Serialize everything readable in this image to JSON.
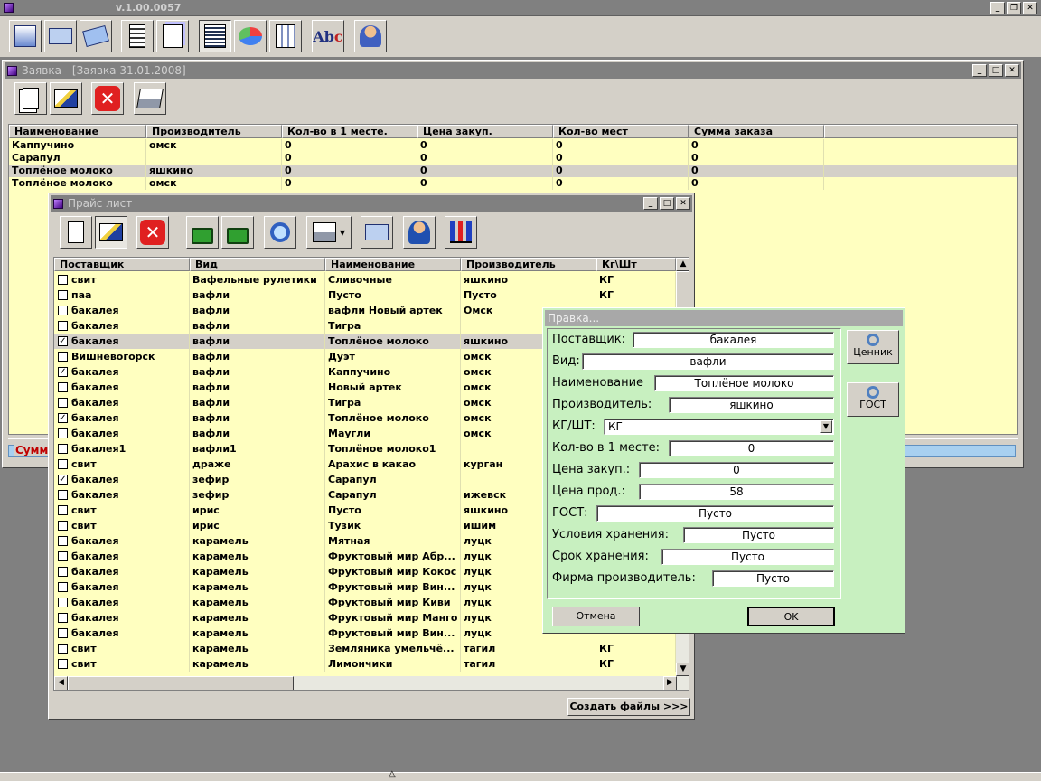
{
  "app": {
    "version": "v.1.00.0057"
  },
  "main_toolbar": [
    "list-icon",
    "mail-icon",
    "mail-multi-icon",
    "document-icon",
    "documents-icon",
    "binary-icon",
    "pie-chart-icon",
    "report-icon",
    "spellcheck-icon",
    "users-icon"
  ],
  "order_window": {
    "title": "Заявка - [Заявка 31.01.2008]",
    "columns": [
      "Наименование",
      "Производитель",
      "Кол-во в 1 месте.",
      "Цена закуп.",
      "Кол-во мест",
      "Сумма заказа"
    ],
    "rows": [
      [
        "Каппучино",
        "омск",
        "0",
        "0",
        "0",
        "0"
      ],
      [
        "Сарапул",
        "",
        "0",
        "0",
        "0",
        "0"
      ],
      [
        "Топлёное молоко",
        "яшкино",
        "0",
        "0",
        "0",
        "0"
      ],
      [
        "Топлёное молоко",
        "омск",
        "0",
        "0",
        "0",
        "0"
      ]
    ],
    "status_label": "Сумма"
  },
  "price_window": {
    "title": "Прайс лист",
    "columns": [
      "Поставщик",
      "Вид",
      "Наименование",
      "Производитель",
      "Кг\\Шт"
    ],
    "rows": [
      {
        "c": false,
        "v": [
          "свит",
          "Вафельные рулетики",
          "Сливочные",
          "яшкино",
          "КГ"
        ]
      },
      {
        "c": false,
        "v": [
          "паа",
          "вафли",
          "Пусто",
          "Пусто",
          "КГ"
        ]
      },
      {
        "c": false,
        "v": [
          "бакалея",
          "вафли",
          "вафли Новый артек",
          " Омск",
          ""
        ]
      },
      {
        "c": false,
        "v": [
          "бакалея",
          "вафли",
          "Тигра",
          "",
          ""
        ]
      },
      {
        "c": true,
        "v": [
          "бакалея",
          "вафли",
          "Топлёное молоко",
          "яшкино",
          ""
        ]
      },
      {
        "c": false,
        "v": [
          "Вишневогорск",
          "вафли",
          "Дуэт",
          "омск",
          ""
        ]
      },
      {
        "c": true,
        "v": [
          "бакалея",
          "вафли",
          "Каппучино",
          "омск",
          ""
        ]
      },
      {
        "c": false,
        "v": [
          "бакалея",
          "вафли",
          "Новый артек",
          "омск",
          ""
        ]
      },
      {
        "c": false,
        "v": [
          "бакалея",
          "вафли",
          "Тигра",
          "омск",
          ""
        ]
      },
      {
        "c": true,
        "v": [
          "бакалея",
          "вафли",
          "Топлёное молоко",
          "омск",
          ""
        ]
      },
      {
        "c": false,
        "v": [
          "бакалея",
          "вафли",
          "Маугли",
          "омск",
          ""
        ]
      },
      {
        "c": false,
        "v": [
          "бакалея1",
          "вафли1",
          "Топлёное молоко1",
          "",
          ""
        ]
      },
      {
        "c": false,
        "v": [
          "свит",
          "драже",
          "Арахис в какао",
          "курган",
          ""
        ]
      },
      {
        "c": true,
        "v": [
          "бакалея",
          "зефир",
          "Сарапул",
          "",
          ""
        ]
      },
      {
        "c": false,
        "v": [
          "бакалея",
          "зефир",
          "Сарапул",
          "ижевск",
          ""
        ]
      },
      {
        "c": false,
        "v": [
          "свит",
          "ирис",
          "Пусто",
          "яшкино",
          ""
        ]
      },
      {
        "c": false,
        "v": [
          "свит",
          "ирис",
          "Тузик",
          "ишим",
          ""
        ]
      },
      {
        "c": false,
        "v": [
          "бакалея",
          "карамель",
          "Мятная",
          "луцк",
          ""
        ]
      },
      {
        "c": false,
        "v": [
          "бакалея",
          "карамель",
          "Фруктовый мир Абр...",
          "луцк",
          ""
        ]
      },
      {
        "c": false,
        "v": [
          "бакалея",
          "карамель",
          "Фруктовый мир Кокос",
          "луцк",
          ""
        ]
      },
      {
        "c": false,
        "v": [
          "бакалея",
          "карамель",
          "Фруктовый мир Вин...",
          "луцк",
          ""
        ]
      },
      {
        "c": false,
        "v": [
          "бакалея",
          "карамель",
          "Фруктовый мир Киви",
          "луцк",
          ""
        ]
      },
      {
        "c": false,
        "v": [
          "бакалея",
          "карамель",
          "Фруктовый мир Манго",
          "луцк",
          ""
        ]
      },
      {
        "c": false,
        "v": [
          "бакалея",
          "карамель",
          "Фруктовый мир Вин...",
          "луцк",
          ""
        ]
      },
      {
        "c": false,
        "v": [
          "свит",
          "карамель",
          "Земляника умельчё...",
          "тагил",
          "КГ"
        ]
      },
      {
        "c": false,
        "v": [
          "свит",
          "карамель",
          "Лимончики",
          "тагил",
          "КГ"
        ]
      }
    ],
    "create_files_label": "Создать файлы >>>"
  },
  "edit_dialog": {
    "title": "Правка...",
    "fields": [
      {
        "label": "Поставщик:",
        "value": "бакалея"
      },
      {
        "label": "Вид:",
        "value": "вафли"
      },
      {
        "label": "Наименование",
        "value": "Топлёное молоко"
      },
      {
        "label": "Производитель:",
        "value": "яшкино"
      },
      {
        "label": "КГ/ШТ:",
        "value": "КГ"
      },
      {
        "label": "Кол-во в 1 месте:",
        "value": "0"
      },
      {
        "label": "Цена закуп.:",
        "value": "0"
      },
      {
        "label": "Цена прод.:",
        "value": "58"
      },
      {
        "label": "ГОСТ:",
        "value": "Пусто"
      },
      {
        "label": "Условия хранения:",
        "value": "Пусто"
      },
      {
        "label": "Срок хранения:",
        "value": "Пусто"
      },
      {
        "label": "Фирма производитель:",
        "value": "Пусто"
      }
    ],
    "price_tag_label": "Ценник",
    "gost_label": "ГОСТ",
    "cancel_label": "Отмена",
    "ok_label": "OK"
  }
}
